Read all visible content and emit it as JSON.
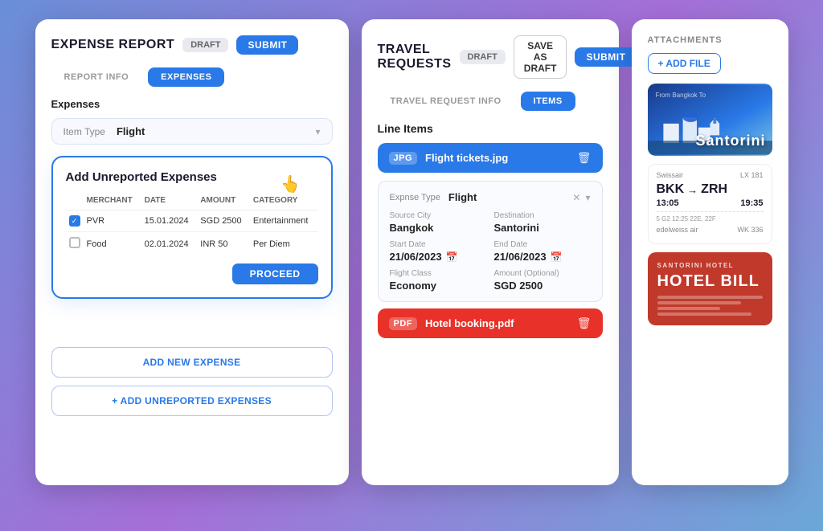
{
  "expense_card": {
    "title": "EXPENSE REPORT",
    "badge_draft": "DRAFT",
    "btn_submit": "SUBMIT",
    "tab_report_info": "REPORT INFO",
    "tab_expenses": "EXPENSES",
    "expenses_label": "Expenses",
    "item_type_label": "Item Type",
    "item_type_value": "Flight",
    "popup": {
      "title": "Add Unreported Expenses",
      "col_merchant": "MERCHANT",
      "col_date": "DATE",
      "col_amount": "AMOUNT",
      "col_category": "CATEGORY",
      "rows": [
        {
          "merchant": "PVR",
          "date": "15.01.2024",
          "amount": "SGD 2500",
          "category": "Entertainment",
          "checked": true
        },
        {
          "merchant": "Food",
          "date": "02.01.2024",
          "amount": "INR 50",
          "category": "Per Diem",
          "checked": false
        }
      ],
      "btn_proceed": "PROCEED"
    },
    "btn_add_new": "ADD NEW EXPENSE",
    "btn_add_unreported": "+ ADD UNREPORTED EXPENSES"
  },
  "travel_card": {
    "title": "TRAVEL REQUESTS",
    "badge_draft": "DRAFT",
    "btn_save_draft": "SAVE AS DRAFT",
    "btn_submit": "SUBMIT",
    "tab_travel_info": "TRAVEL REQUEST INFO",
    "tab_items": "ITEMS",
    "line_items_label": "Line Items",
    "file_jpg": {
      "badge": "JPG",
      "name": "Flight tickets.jpg"
    },
    "flight_details": {
      "expense_type_label": "Expnse Type",
      "expense_type_value": "Flight",
      "source_city_label": "Source City",
      "source_city_value": "Bangkok",
      "destination_label": "Destination",
      "destination_value": "Santorini",
      "start_date_label": "Start Date",
      "start_date_value": "21/06/2023",
      "end_date_label": "End Date",
      "end_date_value": "21/06/2023",
      "flight_class_label": "Flight Class",
      "flight_class_value": "Economy",
      "amount_label": "Amount (Optional)",
      "amount_value": "SGD 2500"
    },
    "file_pdf": {
      "badge": "PDF",
      "name": "Hotel booking.pdf"
    }
  },
  "attachments_card": {
    "title": "ATTACHMENTS",
    "btn_add_file": "+ ADD FILE",
    "santorini_sub": "From Bangkok To",
    "santorini_overlay": "Santorini",
    "boarding": {
      "airline": "Swissair",
      "flight_no": "LX 181",
      "from": "BKK",
      "to": "ZRH",
      "dep_time": "13:05",
      "arr_time": "19:35",
      "seat_info": "5   G2   12:25   22E, 22F",
      "airline2": "edelweiss air",
      "flight_no2": "WK 336"
    },
    "hotel": {
      "name": "SANTORINI HOTEL",
      "bill_text": "HOTEL BILL"
    }
  }
}
